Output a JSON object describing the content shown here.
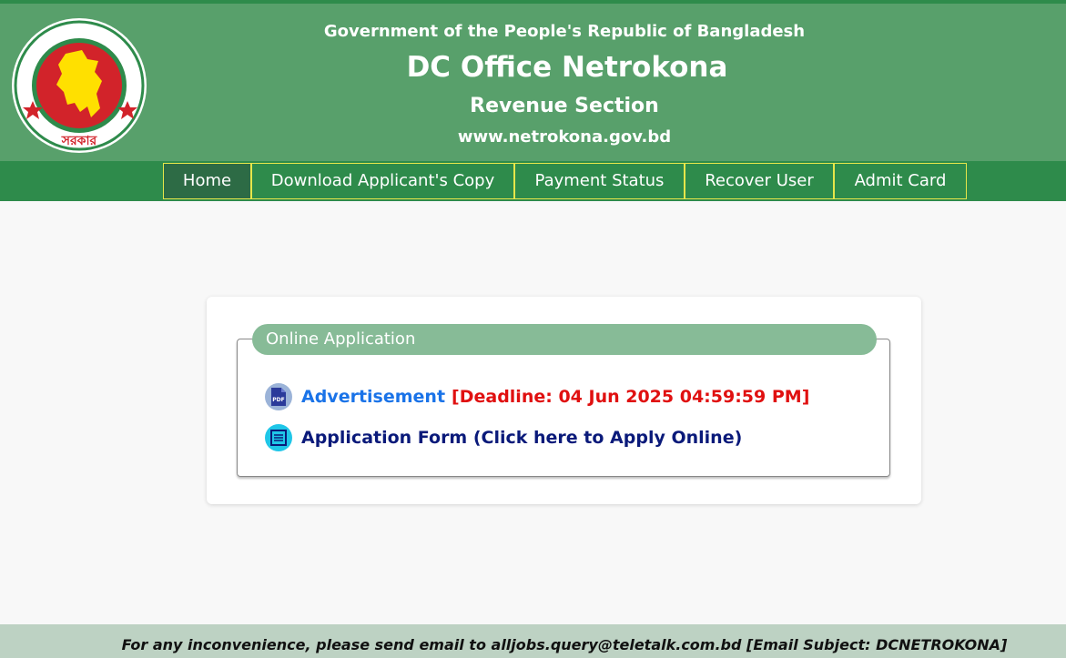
{
  "header": {
    "government": "Government of the People's Republic of Bangladesh",
    "office": "DC Office Netrokona",
    "section": "Revenue Section",
    "website": "www.netrokona.gov.bd",
    "logo_icon": "bangladesh-government-seal-icon"
  },
  "nav": {
    "items": [
      {
        "label": "Home",
        "active": true
      },
      {
        "label": "Download Applicant's Copy",
        "active": false
      },
      {
        "label": "Payment Status",
        "active": false
      },
      {
        "label": "Recover User",
        "active": false
      },
      {
        "label": "Admit Card",
        "active": false
      }
    ]
  },
  "panel": {
    "legend": "Online Application",
    "advertisement": {
      "icon": "pdf-icon",
      "label": "Advertisement",
      "deadline": "[Deadline: 04 Jun 2025 04:59:59 PM]"
    },
    "application_form": {
      "icon": "form-icon",
      "label": "Application Form (Click here to Apply Online)"
    }
  },
  "footer": {
    "text": "For any inconvenience, please send email to alljobs.query@teletalk.com.bd [Email Subject: DCNETROKONA]"
  },
  "colors": {
    "header_green": "#58a06b",
    "nav_green": "#2e8b4b",
    "active_nav": "#2d6b45",
    "link_blue": "#1a73e8",
    "deadline_red": "#e01010",
    "form_link_navy": "#0a1a7a"
  }
}
